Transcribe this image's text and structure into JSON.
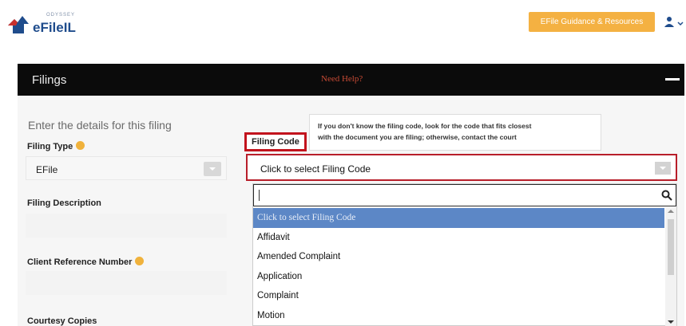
{
  "header": {
    "logo_small": "ODYSSEY",
    "logo_text": "eFileIL",
    "guidance_button": "EFile Guidance & Resources"
  },
  "filings_bar": {
    "title": "Filings",
    "need_help": "Need Help?"
  },
  "form": {
    "heading": "Enter the details for this filing",
    "filing_type_label": "Filing Type",
    "filing_type_value": "EFile",
    "filing_description_label": "Filing Description",
    "client_reference_label": "Client Reference Number",
    "courtesy_copies_label": "Courtesy Copies",
    "filing_code_label": "Filing Code",
    "filing_code_placeholder": "Click to select Filing Code"
  },
  "tooltip": {
    "line1": "If you don't know the filing code, look for the code that fits closest",
    "line2": "with the document you are filing; otherwise, contact the court"
  },
  "dropdown": {
    "search_value": "",
    "items": [
      "Click to select Filing Code",
      "Affidavit",
      "Amended Complaint",
      "Application",
      "Complaint",
      "Motion"
    ],
    "selected_index": 0
  },
  "colors": {
    "accent_orange": "#f4b142",
    "highlight_red": "#c2131d",
    "selected_blue": "#5c87c6",
    "bar_black": "#0b0b0b"
  }
}
